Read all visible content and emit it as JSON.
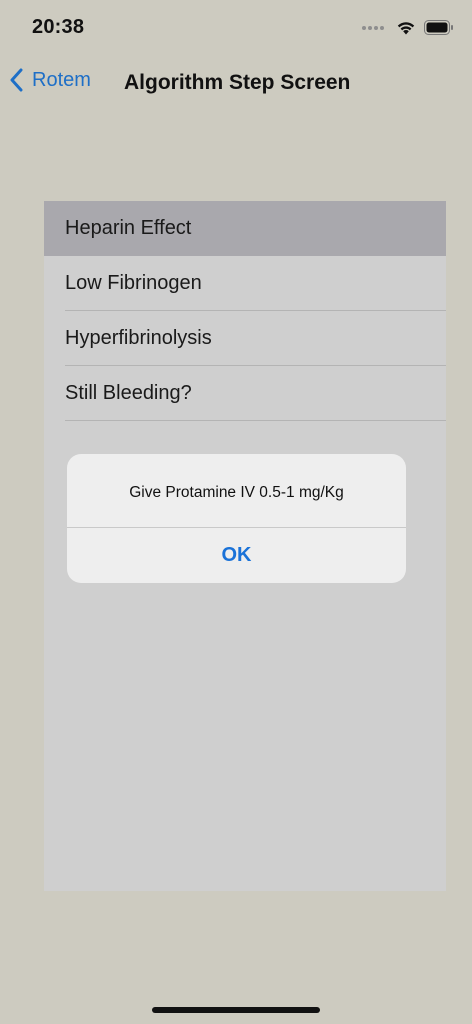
{
  "status_bar": {
    "time": "20:38"
  },
  "nav": {
    "back_label": "Rotem",
    "title": "Algorithm Step Screen"
  },
  "list": {
    "items": [
      {
        "label": "Heparin Effect",
        "selected": true
      },
      {
        "label": "Low Fibrinogen",
        "selected": false
      },
      {
        "label": "Hyperfibrinolysis",
        "selected": false
      },
      {
        "label": "Still Bleeding?",
        "selected": false
      }
    ]
  },
  "alert": {
    "message": "Give Protamine IV 0.5-1 mg/Kg",
    "ok_label": "OK"
  },
  "colors": {
    "accent": "#1e6fc7",
    "background": "#cdcbc0",
    "selected_row": "#a9a8ad"
  }
}
